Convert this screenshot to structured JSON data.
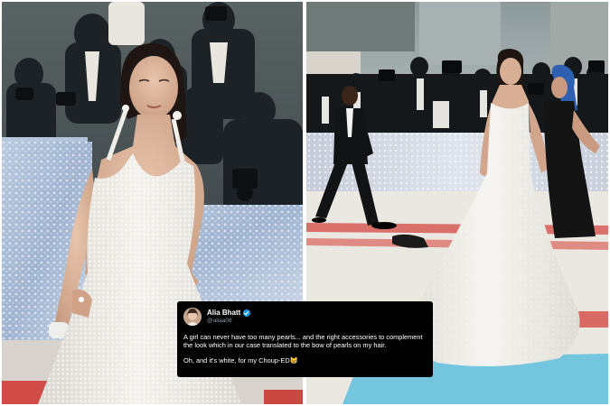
{
  "tweet": {
    "author_name": "Alia Bhatt",
    "author_handle": "@aliaa08",
    "body": "A girl can never have too many pearls... and the right accessories to complement the look which in our case translated to the bow of pearls on my hair.",
    "body_line2": "Oh, and it's white, for my Choup-ED",
    "emoji": "😸"
  },
  "icons": {
    "verified": "verified-badge-icon"
  },
  "colors": {
    "tweet_bg": "#000000",
    "verified_blue": "#1d9bf0",
    "carpet_red": "#d96a63",
    "carpet_blue": "#74c6df",
    "gown": "#f1efe8"
  }
}
